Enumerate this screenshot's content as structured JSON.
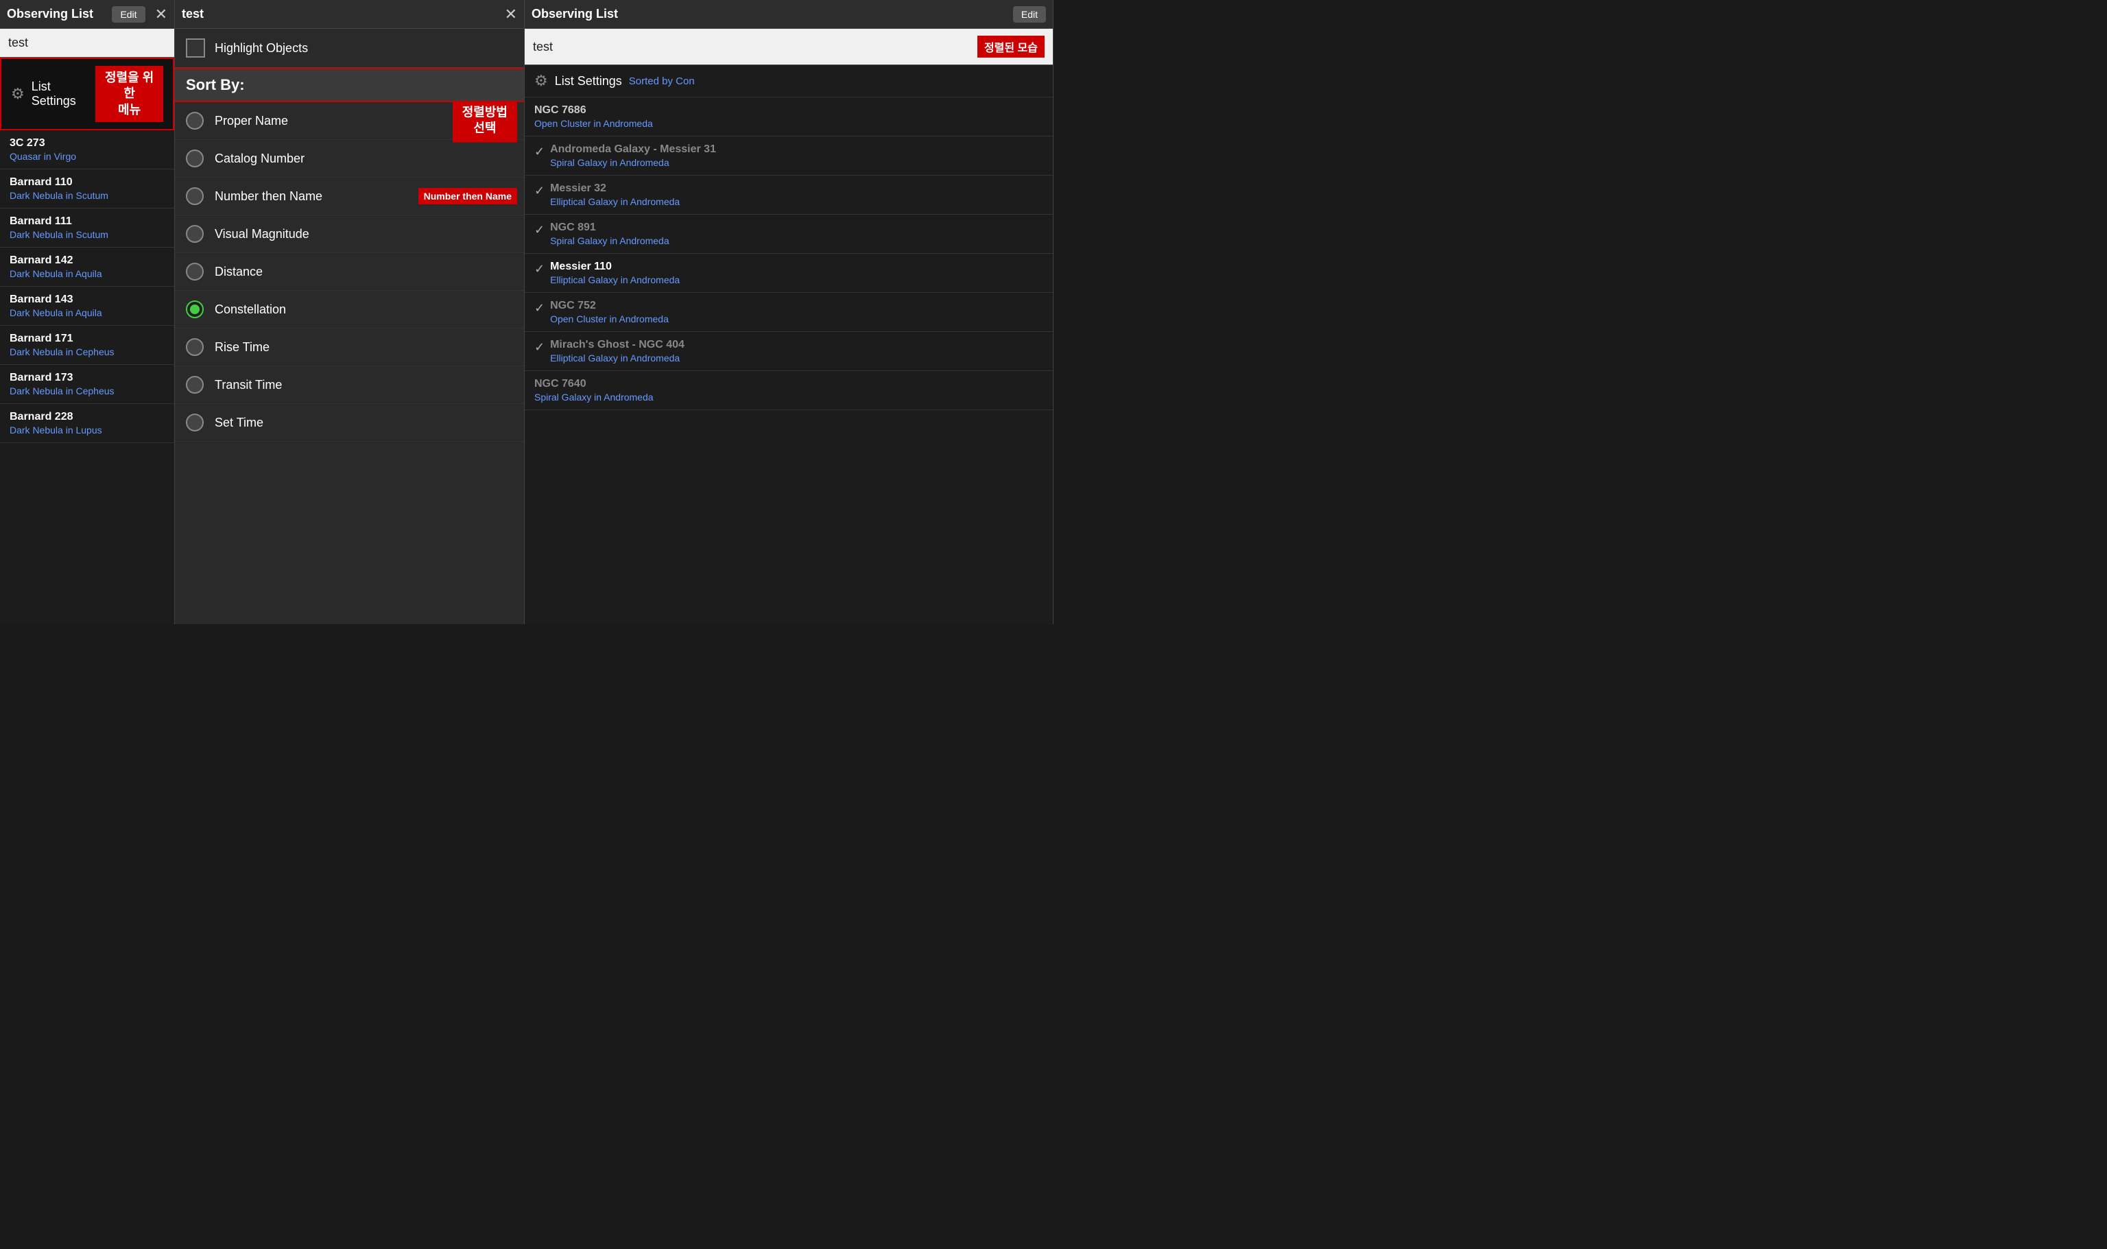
{
  "panels": {
    "left": {
      "title": "Observing List",
      "edit_button": "Edit",
      "close_symbol": "✕",
      "search_value": "test",
      "list_settings_label": "List Settings",
      "annotation_text": "정렬을 위한\n메뉴",
      "objects": [
        {
          "name": "3C 273",
          "desc": "Quasar in Virgo"
        },
        {
          "name": "Barnard 110",
          "desc": "Dark Nebula in Scutum"
        },
        {
          "name": "Barnard 111",
          "desc": "Dark Nebula in Scutum"
        },
        {
          "name": "Barnard 142",
          "desc": "Dark Nebula in Aquila"
        },
        {
          "name": "Barnard 143",
          "desc": "Dark Nebula in Aquila"
        },
        {
          "name": "Barnard 171",
          "desc": "Dark Nebula in Cepheus"
        },
        {
          "name": "Barnard 173",
          "desc": "Dark Nebula in Cepheus"
        },
        {
          "name": "Barnard 228",
          "desc": "Dark Nebula in Lupus"
        }
      ]
    },
    "middle": {
      "title": "test",
      "close_symbol": "✕",
      "highlight_label": "Highlight Objects",
      "sort_by_label": "Sort By:",
      "sort_options": [
        {
          "id": "proper-name",
          "label": "Proper Name",
          "selected": false
        },
        {
          "id": "catalog-number",
          "label": "Catalog Number",
          "selected": false
        },
        {
          "id": "number-then-name",
          "label": "Number then Name",
          "selected": false
        },
        {
          "id": "visual-magnitude",
          "label": "Visual Magnitude",
          "selected": false
        },
        {
          "id": "distance",
          "label": "Distance",
          "selected": false
        },
        {
          "id": "constellation",
          "label": "Constellation",
          "selected": true
        },
        {
          "id": "rise-time",
          "label": "Rise Time",
          "selected": false
        },
        {
          "id": "transit-time",
          "label": "Transit Time",
          "selected": false
        },
        {
          "id": "set-time",
          "label": "Set Time",
          "selected": false
        }
      ],
      "proper_name_annotation": "정렬방법\n선택",
      "number_then_name_annotation": "Number then Name"
    },
    "right": {
      "title": "Observing List",
      "edit_button": "Edit",
      "search_value": "test",
      "sorted_badge": "정렬된 모습",
      "list_settings_label": "List Settings",
      "sorted_con_label": "Sorted by Con",
      "objects": [
        {
          "name": "NGC 7686",
          "desc": "Open Cluster in Andromeda",
          "checked": false
        },
        {
          "name": "Andromeda Galaxy - Messier 31",
          "desc": "Spiral Galaxy in Andromeda",
          "checked": true,
          "dim": true
        },
        {
          "name": "Messier 32",
          "desc": "Elliptical Galaxy in Andromeda",
          "checked": true,
          "dim": true
        },
        {
          "name": "NGC 891",
          "desc": "Spiral Galaxy in Andromeda",
          "checked": true,
          "dim": true
        },
        {
          "name": "Messier 110",
          "desc": "Elliptical Galaxy in Andromeda",
          "checked": true,
          "highlight": true
        },
        {
          "name": "NGC 752",
          "desc": "Open Cluster in Andromeda",
          "checked": true,
          "dim": true
        },
        {
          "name": "Mirach's Ghost - NGC 404",
          "desc": "Elliptical Galaxy in Andromeda",
          "checked": true,
          "dim": true
        },
        {
          "name": "NGC 7640",
          "desc": "Spiral Galaxy in Andromeda",
          "checked": false,
          "dim": true
        }
      ]
    }
  }
}
